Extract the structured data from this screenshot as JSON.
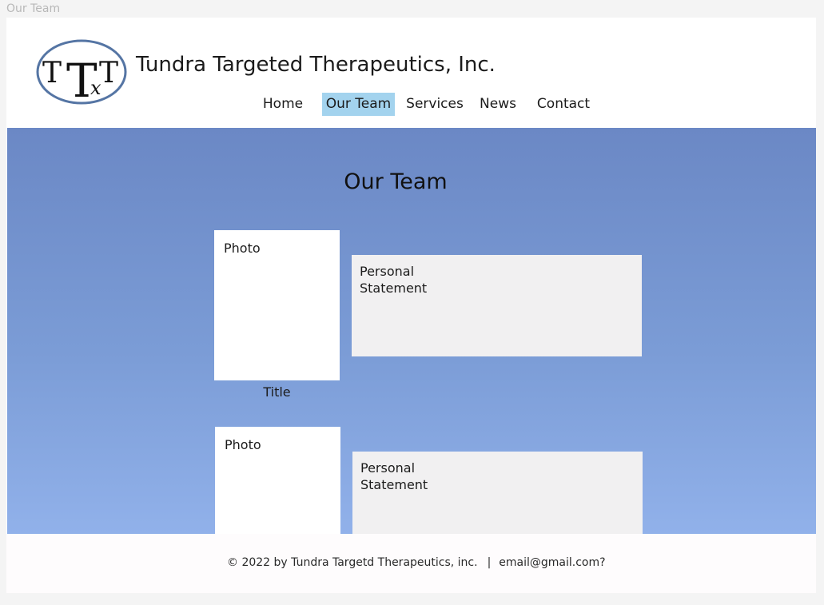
{
  "frame": {
    "label": "Our Team"
  },
  "header": {
    "logo_text": "TTxT",
    "company_name": "Tundra Targeted Therapeutics, Inc."
  },
  "nav": {
    "items": [
      {
        "label": "Home"
      },
      {
        "label": "Our Team",
        "active": true
      },
      {
        "label": "Services"
      },
      {
        "label": "News"
      },
      {
        "label": "Contact"
      }
    ]
  },
  "main": {
    "title": "Our Team",
    "members": [
      {
        "photo_label": "Photo",
        "statement_line1": "Personal",
        "statement_line2": "Statement",
        "title": "Title"
      },
      {
        "photo_label": "Photo",
        "statement_line1": "Personal",
        "statement_line2": "Statement"
      }
    ]
  },
  "footer": {
    "copyright": "© 2022 by Tundra Targetd Therapeutics, inc.",
    "separator": "|",
    "email": "email@gmail.com?"
  },
  "colors": {
    "active_nav": "#a3d3ee",
    "hero_top": "#6b88c5",
    "hero_bottom": "#91b1ea",
    "logo_ring": "#5575a4"
  }
}
